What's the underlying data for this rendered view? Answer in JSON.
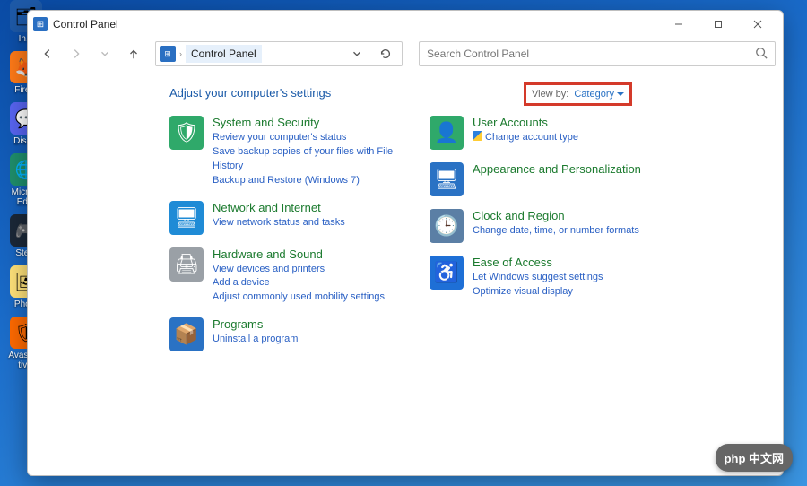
{
  "desktop_icons": [
    {
      "label": "In...",
      "bg": "#1e5aa8",
      "glyph": "🗂"
    },
    {
      "label": "Fire...",
      "bg": "#ff7a18",
      "glyph": "🦊"
    },
    {
      "label": "Disc...",
      "bg": "#5865f2",
      "glyph": "💬"
    },
    {
      "label": "Micro... Ed...",
      "bg": "#1f8f6c",
      "glyph": "🌐"
    },
    {
      "label": "Ste...",
      "bg": "#1b2838",
      "glyph": "🎮"
    },
    {
      "label": "Pho...",
      "bg": "#ffe27a",
      "glyph": "🖼"
    },
    {
      "label": "Avast Antiv...",
      "bg": "#ff6a00",
      "glyph": "🛡"
    }
  ],
  "window": {
    "title": "Control Panel",
    "breadcrumb": "Control Panel",
    "search_placeholder": "Search Control Panel",
    "heading": "Adjust your computer's settings",
    "viewby_label": "View by:",
    "viewby_value": "Category"
  },
  "left_categories": [
    {
      "icon": "🛡",
      "iconbg": "#2fa96a",
      "title": "System and Security",
      "links": [
        {
          "text": "Review your computer's status"
        },
        {
          "text": "Save backup copies of your files with File History"
        },
        {
          "text": "Backup and Restore (Windows 7)"
        }
      ]
    },
    {
      "icon": "🖥",
      "iconbg": "#1f8bd6",
      "title": "Network and Internet",
      "links": [
        {
          "text": "View network status and tasks"
        }
      ]
    },
    {
      "icon": "🖨",
      "iconbg": "#9aa0a6",
      "title": "Hardware and Sound",
      "links": [
        {
          "text": "View devices and printers"
        },
        {
          "text": "Add a device"
        },
        {
          "text": "Adjust commonly used mobility settings"
        }
      ]
    },
    {
      "icon": "📦",
      "iconbg": "#2a72c4",
      "title": "Programs",
      "links": [
        {
          "text": "Uninstall a program"
        }
      ]
    }
  ],
  "right_categories": [
    {
      "icon": "👤",
      "iconbg": "#2fa96a",
      "title": "User Accounts",
      "links": [
        {
          "text": "Change account type",
          "shield": true
        }
      ]
    },
    {
      "icon": "🖥",
      "iconbg": "#2a72c4",
      "title": "Appearance and Personalization",
      "links": []
    },
    {
      "icon": "🕒",
      "iconbg": "#5b7fa5",
      "title": "Clock and Region",
      "links": [
        {
          "text": "Change date, time, or number formats"
        }
      ]
    },
    {
      "icon": "♿",
      "iconbg": "#1e6fd6",
      "title": "Ease of Access",
      "links": [
        {
          "text": "Let Windows suggest settings"
        },
        {
          "text": "Optimize visual display"
        }
      ]
    }
  ],
  "badge_text": "php 中文网"
}
